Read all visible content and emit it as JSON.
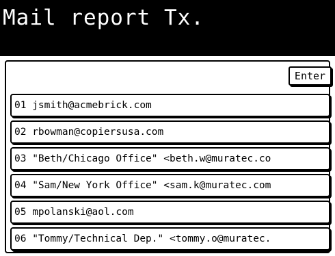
{
  "screen": {
    "title": "Mail report Tx.",
    "enter_label": "Enter"
  },
  "entries": [
    {
      "text": "01 jsmith@acmebrick.com"
    },
    {
      "text": "02 rbowman@copiersusa.com"
    },
    {
      "text": "03 \"Beth/Chicago Office\" <beth.w@muratec.co"
    },
    {
      "text": "04 \"Sam/New York Office\" <sam.k@muratec.com"
    },
    {
      "text": "05 mpolanski@aol.com"
    },
    {
      "text": "06 \"Tommy/Technical Dep.\" <tommy.o@muratec."
    }
  ],
  "colors": {
    "header_bg": "#000000",
    "header_text": "#ffffff",
    "body_bg": "#ffffff",
    "border": "#000000"
  }
}
